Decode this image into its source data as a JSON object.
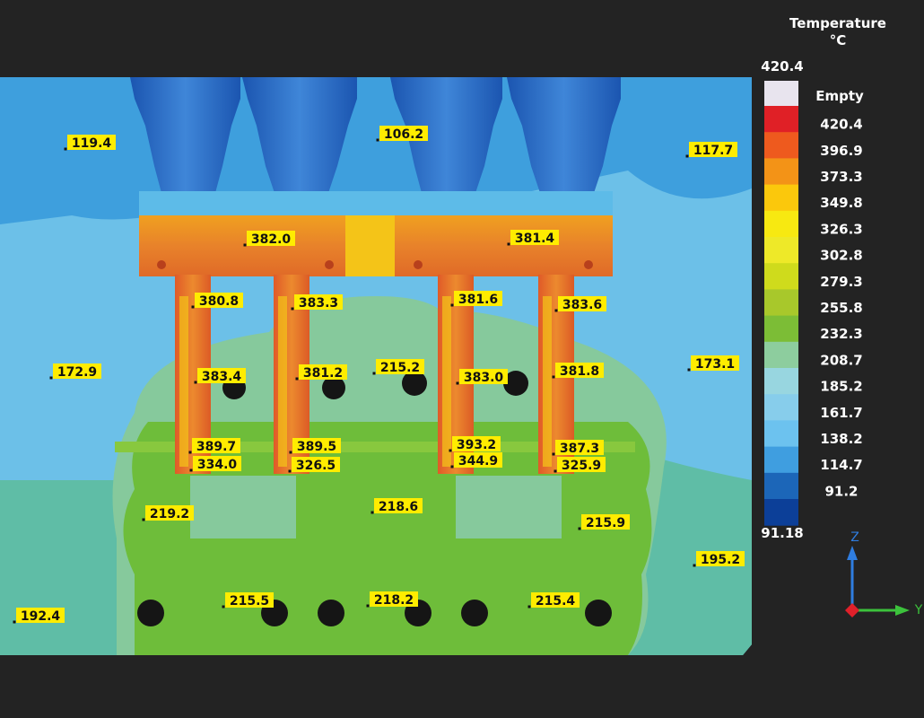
{
  "chart_data": {
    "type": "heatmap",
    "legend": {
      "title": "Temperature",
      "unit": "°C",
      "max_label": "420.4",
      "min_label": "91.18",
      "empty_label": "Empty",
      "empty_color": "#e8e4ee",
      "bands": [
        {
          "label": "420.4",
          "color": "#e02026"
        },
        {
          "label": "396.9",
          "color": "#ee5a1e"
        },
        {
          "label": "373.3",
          "color": "#f39317"
        },
        {
          "label": "349.8",
          "color": "#fbc80c"
        },
        {
          "label": "326.3",
          "color": "#f7e911"
        },
        {
          "label": "302.8",
          "color": "#eee928"
        },
        {
          "label": "279.3",
          "color": "#cfdb1c"
        },
        {
          "label": "255.8",
          "color": "#a8c82b"
        },
        {
          "label": "232.3",
          "color": "#7cbd36"
        },
        {
          "label": "208.7",
          "color": "#8dcd9e"
        },
        {
          "label": "185.2",
          "color": "#98d6e0"
        },
        {
          "label": "161.7",
          "color": "#87cdeb"
        },
        {
          "label": "138.2",
          "color": "#6cc2ef"
        },
        {
          "label": "114.7",
          "color": "#3f9ee0"
        },
        {
          "label": "91.2",
          "color": "#1c66b8"
        },
        {
          "label": "",
          "color": "#0c3f98"
        }
      ]
    },
    "probes": [
      {
        "label": "119.4",
        "region": "air-top-left"
      },
      {
        "label": "106.2",
        "region": "air-top-center"
      },
      {
        "label": "117.7",
        "region": "air-top-right"
      },
      {
        "label": "382.0",
        "region": "manifold-left"
      },
      {
        "label": "381.4",
        "region": "manifold-right"
      },
      {
        "label": "380.8",
        "region": "nozzle-1-top"
      },
      {
        "label": "383.3",
        "region": "nozzle-2-top"
      },
      {
        "label": "381.6",
        "region": "nozzle-3-top"
      },
      {
        "label": "383.6",
        "region": "nozzle-4-top"
      },
      {
        "label": "172.9",
        "region": "air-mid-left"
      },
      {
        "label": "173.1",
        "region": "air-mid-right"
      },
      {
        "label": "383.4",
        "region": "nozzle-1-mid"
      },
      {
        "label": "381.2",
        "region": "nozzle-2-mid"
      },
      {
        "label": "215.2",
        "region": "plate-center"
      },
      {
        "label": "383.0",
        "region": "nozzle-3-mid"
      },
      {
        "label": "381.8",
        "region": "nozzle-4-mid"
      },
      {
        "label": "389.7",
        "region": "nozzle-1-tip"
      },
      {
        "label": "389.5",
        "region": "nozzle-2-tip"
      },
      {
        "label": "393.2",
        "region": "nozzle-3-tip"
      },
      {
        "label": "387.3",
        "region": "nozzle-4-tip"
      },
      {
        "label": "334.0",
        "region": "gate-1"
      },
      {
        "label": "326.5",
        "region": "gate-2"
      },
      {
        "label": "344.9",
        "region": "gate-3"
      },
      {
        "label": "325.9",
        "region": "gate-4"
      },
      {
        "label": "219.2",
        "region": "cavity-left"
      },
      {
        "label": "218.6",
        "region": "cavity-center"
      },
      {
        "label": "215.9",
        "region": "cavity-right"
      },
      {
        "label": "195.2",
        "region": "air-low-right"
      },
      {
        "label": "215.5",
        "region": "base-left"
      },
      {
        "label": "218.2",
        "region": "base-center"
      },
      {
        "label": "215.4",
        "region": "base-right"
      },
      {
        "label": "192.4",
        "region": "air-low-left"
      }
    ]
  },
  "axes_triad": {
    "z": "Z",
    "y": "Y",
    "z_color": "#2f7de0",
    "y_color": "#3cc23c",
    "origin_color": "#e0202a"
  },
  "colors": {
    "background": "#232323",
    "label_fill": "#ffec00",
    "label_stroke": "#5a4a00"
  }
}
